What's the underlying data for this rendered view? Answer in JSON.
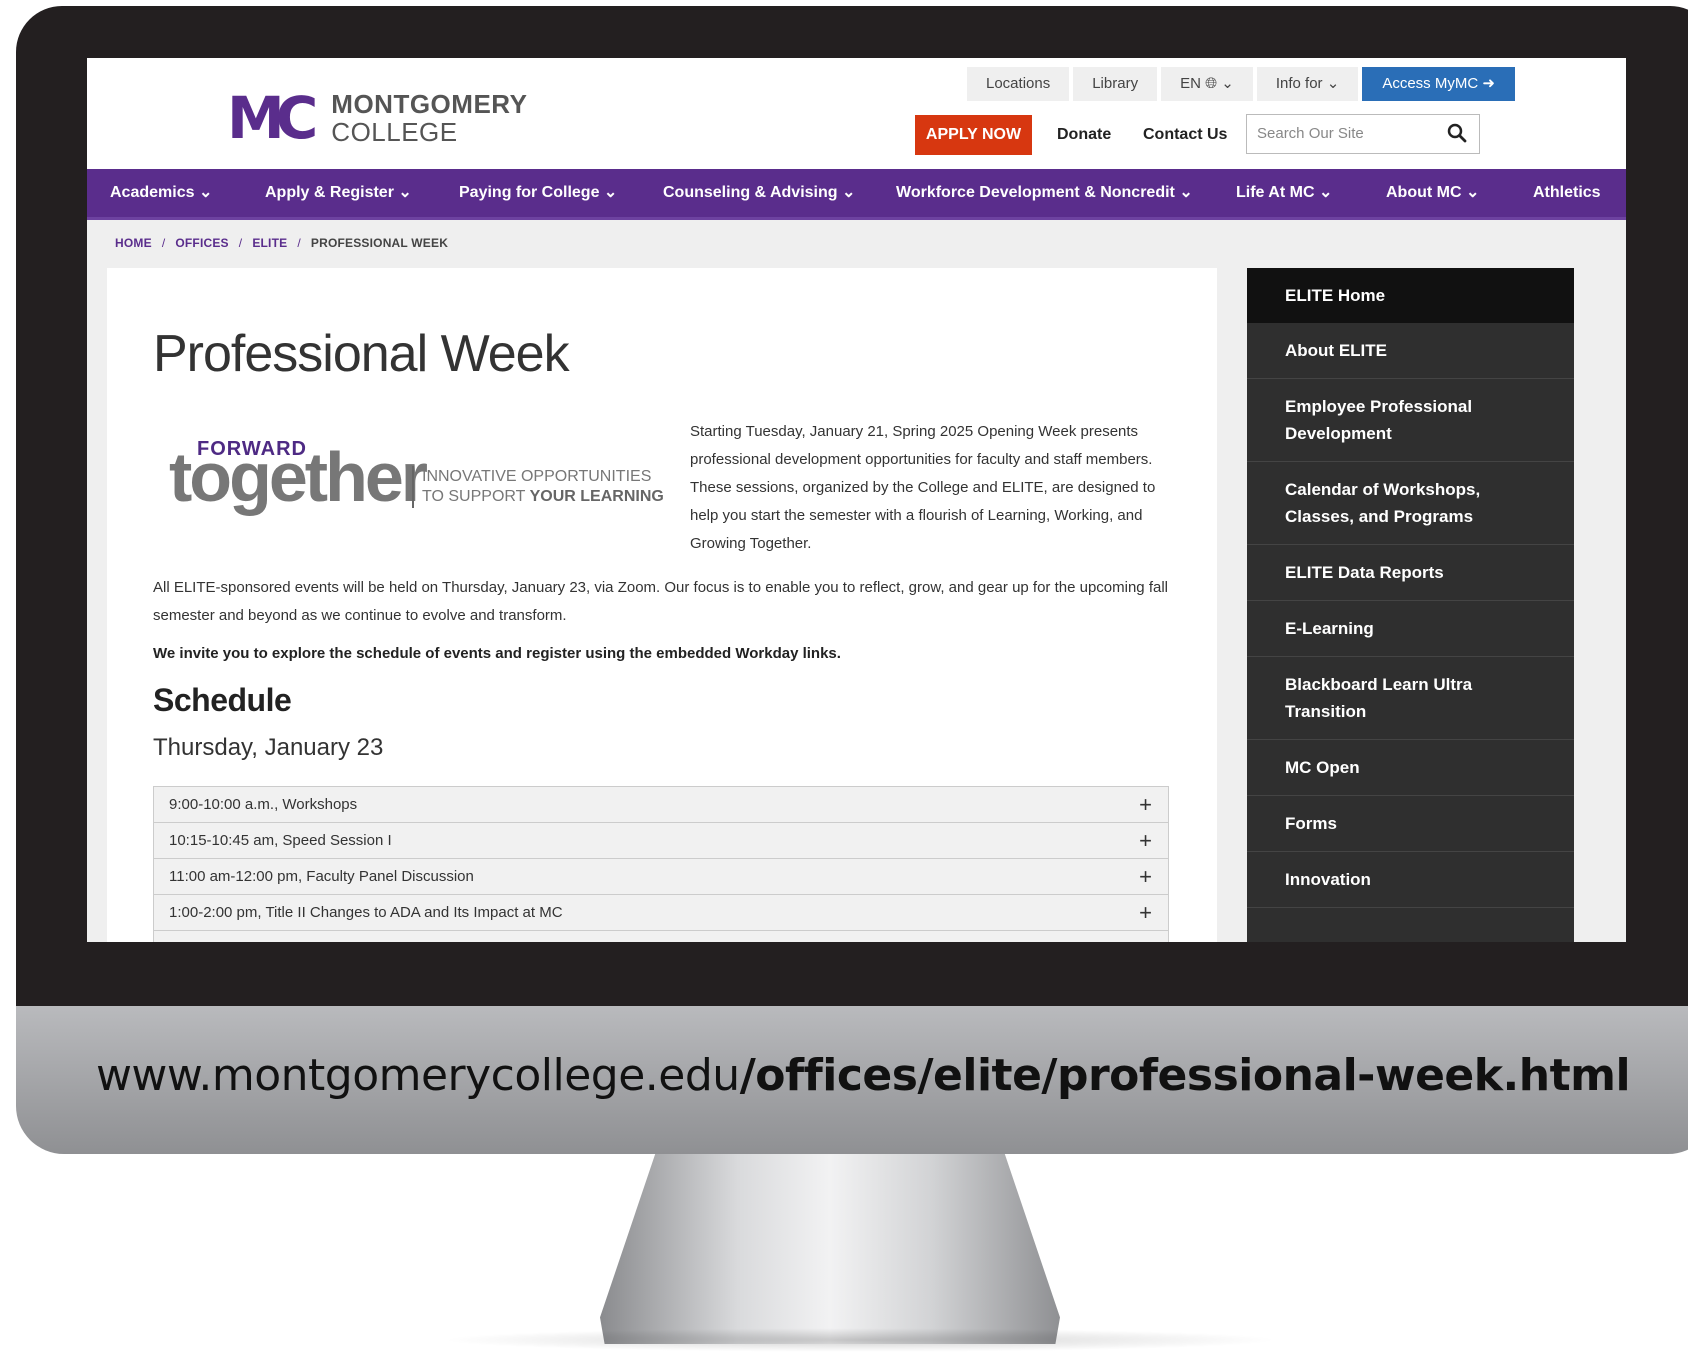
{
  "url": {
    "domain": "www.montgomerycollege.edu",
    "path": "/offices/elite/professional-week.html"
  },
  "logo": {
    "mark": "MC",
    "line1": "MONTGOMERY",
    "line2": "COLLEGE"
  },
  "utility_nav": {
    "locations": "Locations",
    "library": "Library",
    "language": "EN",
    "info_for": "Info for",
    "access": "Access MyMC"
  },
  "header": {
    "apply": "APPLY NOW",
    "donate": "Donate",
    "contact": "Contact Us",
    "search_placeholder": "Search Our Site"
  },
  "main_nav": [
    {
      "label": "Academics"
    },
    {
      "label": "Apply & Register"
    },
    {
      "label": "Paying for College"
    },
    {
      "label": "Counseling & Advising"
    },
    {
      "label": "Workforce Development & Noncredit"
    },
    {
      "label": "Life At MC"
    },
    {
      "label": "About MC"
    },
    {
      "label": "Athletics"
    }
  ],
  "breadcrumb": {
    "home": "HOME",
    "offices": "OFFICES",
    "elite": "ELITE",
    "current": "PROFESSIONAL WEEK"
  },
  "page": {
    "title": "Professional Week",
    "banner": {
      "forward": "FORWARD",
      "together": "together",
      "tag_line1": "INNOVATIVE OPPORTUNITIES",
      "tag_line2_prefix": "TO SUPPORT ",
      "tag_line2_bold": "YOUR LEARNING"
    },
    "intro": "Starting Tuesday, January 21, Spring 2025 Opening Week presents professional development opportunities for faculty and staff members. These sessions, organized by the College and ELITE, are designed to help you start the semester with a flourish of Learning, Working, and Growing Together.",
    "para1": "All ELITE-sponsored events will be held on Thursday, January 23, via Zoom. Our focus is to enable you to reflect, grow, and gear up for the upcoming fall semester and beyond as we continue to evolve and transform.",
    "para2": "We invite you to explore the schedule of events and register using the embedded Workday links.",
    "schedule_heading": "Schedule",
    "day_heading": "Thursday, January 23",
    "sessions": [
      "9:00-10:00 a.m., Workshops",
      "10:15-10:45 am, Speed Session I",
      "11:00 am-12:00 pm, Faculty Panel Discussion",
      "1:00-2:00 pm, Title II Changes to ADA and Its Impact at MC"
    ]
  },
  "sidebar": [
    "ELITE Home",
    "About ELITE",
    "Employee Professional Development",
    "Calendar of Workshops, Classes, and Programs",
    "ELITE Data Reports",
    "E-Learning",
    "Blackboard Learn Ultra Transition",
    "MC Open",
    "Forms",
    "Innovation"
  ],
  "colors": {
    "brand_purple": "#5a2d8c",
    "apply_red": "#d73710",
    "access_blue": "#2a6eb7",
    "sidebar_dark": "#2f2f2f",
    "sidebar_active": "#111111"
  }
}
